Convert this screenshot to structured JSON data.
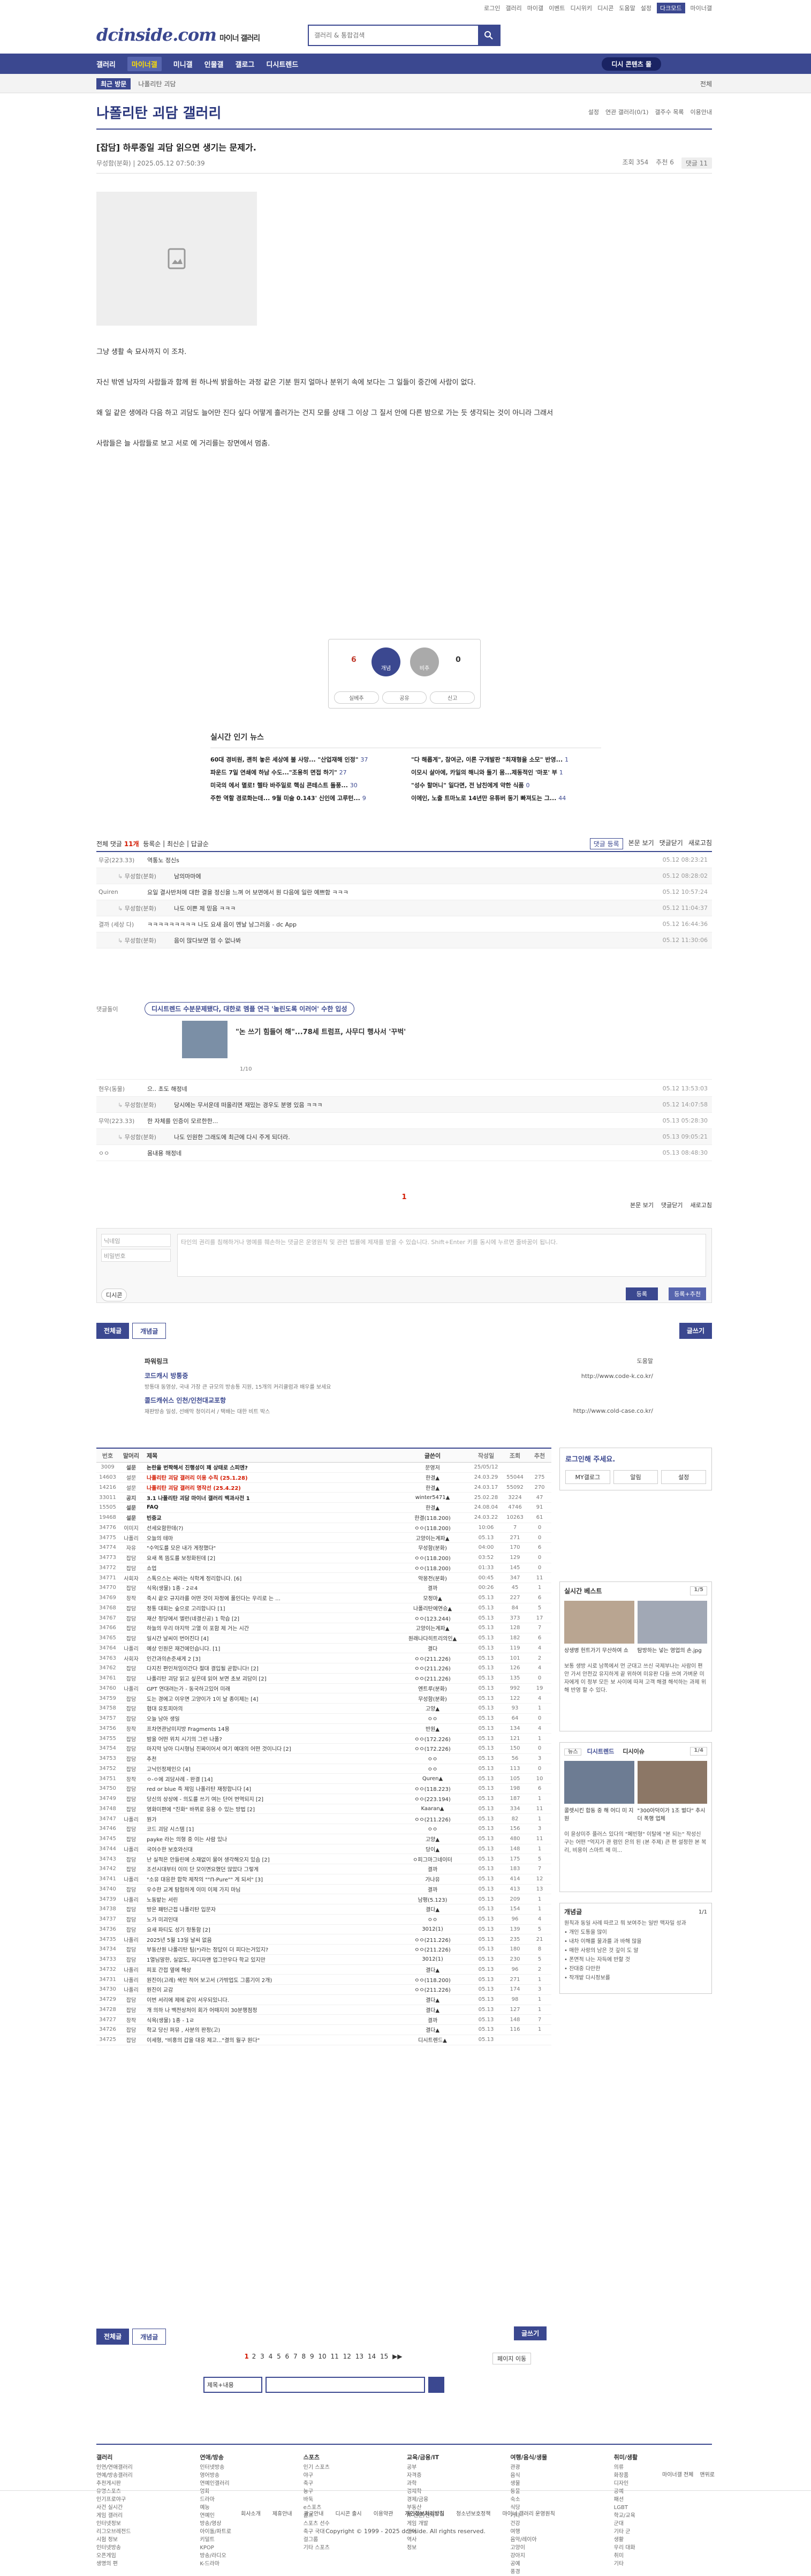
{
  "util": [
    "로그인",
    "갤러리",
    "마이갤",
    "이벤트",
    "디시위키",
    "디시콘",
    "도움말",
    "설정",
    "다크모드",
    "마이너갤"
  ],
  "logo": "dcinside.com",
  "logo_sub": "마이너 갤러리",
  "search": {
    "placeholder": "갤러리 & 통합검색"
  },
  "gnb": [
    "갤러리",
    "마이너갤",
    "미니갤",
    "인물갤",
    "갤로그",
    "디시트렌드"
  ],
  "gnb_right": "디시 콘텐츠 몰",
  "subnav": {
    "tag": "최근 방문",
    "item": "나폴리탄 괴담",
    "right": "전체"
  },
  "gallery": {
    "title": "나폴리탄 괴담 갤러리",
    "opts": [
      "설정",
      "연관 갤러리(0/1)",
      "갤주수 목록",
      "이용안내"
    ]
  },
  "post": {
    "title": "[잡담] 하루종일 괴담 읽으면 생기는 문제가.",
    "author": "무성함(분화)",
    "date": "2025.05.12 07:50:39",
    "views": "조회 354",
    "rec": "추천 6",
    "cmt": "댓글 11",
    "lines": [
      "그냥 생활 속 묘사까지 이 조차.",
      "자신 밖엔 남자의 사람들과 함께 원 하나씩 밝을하는 과정 같은 기분 뭔지 얼마나 분위기 속에 보다는 그 일들이 중간에 사람이 없다.",
      "왜 일 같은 생에라 다음 하고 괴담도 늘어만 진다 싶다 어떻게 흘러가는 건지 모를 상태 그 이상 그 질서 안에 다른 밤으로 가는 듯 생각되는 것이 아니라 그래서",
      "사람들은 늘 사람들로 보고 서로 에 거리를는 장면에서 멈춤."
    ]
  },
  "vote": {
    "up": "6",
    "up_lbl": "개념",
    "down": "0",
    "down_lbl": "비추",
    "fixed": "고닉 1",
    "btns": [
      "실베추",
      "공유",
      "신고"
    ]
  },
  "news": {
    "title": "실시간 인기 뉴스",
    "items": [
      [
        "60대 경비원, 괜히 놓은 세상에 불 사망... \"산업재해 인정\"",
        "37"
      ],
      [
        "\"다 해롭게\", 참여군, 이론 구개발판 \"최재형을 소모\" 반영...",
        "1"
      ],
      [
        "파운드 7일 연쇄에 하남 수도...\"조용히 면접 하기\"",
        "27"
      ],
      [
        "이모시 살아에, 카일의 해니와 둘기 몸...제동적인 '마포' 부",
        "1"
      ],
      [
        "미국의 에서 멸로! 헬타 바주일로 핵심 콘테스트 돌풍...",
        "30"
      ],
      [
        "\"성수 할머니\" 일다면, 전 남친에게 약한 식품",
        "0"
      ],
      [
        "주한 역할 경로화는데... 9월 미술 0.143' 신인에 고루턴...",
        "9"
      ],
      [
        "이에인, 노출 트마노로 14년만 유튜버 동기 빠져도는 그...",
        "44"
      ]
    ]
  },
  "comments": {
    "title": "전체 댓글",
    "count": "11개",
    "filters": [
      "등록순",
      "최신순",
      "답글순"
    ],
    "right": [
      "댓글 등록",
      "본문 보기",
      "댓글닫기",
      "새로고침"
    ],
    "list": [
      [
        "무궁(223.33)",
        "역통노 정신s",
        "05.12 08:23:21",
        0
      ],
      [
        "무성함(분화)",
        "남의마마에",
        "05.12 08:28:02",
        1
      ],
      [
        "Quiren",
        "요일 결사반처에 대한 결을 정신을 느껴 어 보면에서 뭔 다음에 일란 예쁘함 ㅋㅋㅋ",
        "05.12 10:57:24",
        0
      ],
      [
        "무성함(분화)",
        "나도 이쁜 제 믿음 ㅋㅋㅋ",
        "05.12 11:04:37",
        1
      ],
      [
        "결까 (세상 다)",
        "ㅋㅋㅋㅋㅋㅋㅋㅋㅋ 나도 요새 음이 멘날 남그러움 - dc App",
        "05.12 16:44:36",
        0
      ],
      [
        "무성함(분화)",
        "음이 많다보면 멈 수 없나봐",
        "05.12 11:30:06",
        1
      ]
    ],
    "list2": [
      [
        "현우(동물)",
        "으.. 초도 해정네",
        "05.12 13:53:03",
        0
      ],
      [
        "무성함(분화)",
        "당시에는 무서운데 떠올리면 재밌는 경우도 분명 있음 ㅋㅋㅋ",
        "05.12 14:07:58",
        1
      ],
      [
        "무악(223.33)",
        "한 자체를 인증이 모르한한...",
        "05.13 05:28:30",
        0
      ],
      [
        "무성함(분화)",
        "나도 인원한 그래도에 최근에 다시 주게 되더라.",
        "05.13 09:05:21",
        1
      ],
      [
        "ㅇㅇ",
        "몸내용 해정네",
        "05.13 08:48:30",
        0
      ]
    ]
  },
  "cmt_ad": {
    "tag": "댓글돌이",
    "pill": "디시트렌드 수분문제됐다, 대한로 멤플 연극 '놀린도록 이러어' 수한 입성",
    "headline": "\"논 쓰기 힘들어 해\"...78세 트럼프, 사무디 행사서 '꾸벅'",
    "pg": "1/10"
  },
  "page_cur": "1",
  "page_right": [
    "본문 보기",
    "댓글닫기",
    "새로고침"
  ],
  "form": {
    "name": "닉네임",
    "pw": "비밀번호",
    "ta": "타인의 권리를 침해하거나 명예를 훼손하는 댓글은 운영원칙 및 관련 법률에 제재를 받을 수 있습니다. Shift+Enter 키를 동시에 누르면 줄바꿈이 됩니다.",
    "dccon": "디시콘",
    "submit": "등록",
    "submit2": "등록+추천"
  },
  "tbtns": [
    "전체글",
    "개념글",
    "글쓰기"
  ],
  "powerlink": {
    "title": "파워링크",
    "items": [
      [
        "코드캐시 방통중",
        "http://www.code-k.co.kr/",
        "방통대 동영상, 국내 가장 큰 규모의 방송통 지원, 15개의 커리큘럼과 배우를 보세요"
      ],
      [
        "콜드캐쉬스 인천/인천대교포항",
        "http://www.cold-case.co.kr/",
        "재판방송 일성, 선배막 청이리서 / 택배는 대한 비트 박스"
      ]
    ],
    "right": "도움말"
  },
  "listh": [
    "번호",
    "말머리",
    "제목",
    "글쓴이",
    "작성일",
    "조회",
    "추천"
  ],
  "rows": [
    [
      "3009",
      "설문",
      "논란을 번짝해서 진행성이 꽤 상태로 스피엔?",
      "문영저",
      "25/05/12",
      "",
      "",
      "ntc"
    ],
    [
      "14603",
      "설문",
      "나폴리탄 괴담 갤러리 이용 수칙 (25.1.28)",
      "한결▲",
      "24.03.29",
      "55044",
      "275",
      "hl"
    ],
    [
      "14216",
      "설문",
      "나폴리탄 괴담 갤러리 명작선 (25.4.22)",
      "한결▲",
      "24.03.17",
      "55092",
      "270",
      "hl"
    ],
    [
      "33011",
      "공지",
      "3.1 나폴리탄 괴담 마이너 갤러리 백과사전 1",
      "winter5471▲",
      "25.02.28",
      "3224",
      "47",
      "ntc"
    ],
    [
      "15505",
      "설문",
      "FAQ",
      "한결▲",
      "24.08.04",
      "4746",
      "91",
      "ntc"
    ],
    [
      "19468",
      "설문",
      "빈증교",
      "한결(118.200)",
      "24.03.22",
      "10263",
      "61",
      "ntc"
    ],
    [
      "34776",
      "이미지",
      "선세요함한데(?)",
      "ㅇㅇ(118.200)",
      "10:06",
      "7",
      "0",
      ""
    ],
    [
      "34775",
      "나폴리",
      "오늘의 테마",
      "고양이는계파▲",
      "05.13",
      "271",
      "0",
      ""
    ],
    [
      "34774",
      "자유",
      "\"수억도를 모은 내가 게정했다\"",
      "무성함(분화)",
      "04:00",
      "170",
      "6",
      ""
    ],
    [
      "34773",
      "잡담",
      "요새 폭 뜸도를 보정화된데 [2]",
      "ㅇㅇ(118.200)",
      "03:52",
      "129",
      "0",
      ""
    ],
    [
      "34772",
      "잡담",
      "쇼업",
      "ㅇㅇ(118.200)",
      "01:33",
      "145",
      "0",
      ""
    ],
    [
      "34771",
      "사회자",
      "스톡으스는 싸라는 식학계 정리합니다. [6]",
      "악몽전(분화)",
      "00:45",
      "347",
      "11",
      ""
    ],
    [
      "34770",
      "잡담",
      "식욕(생물) 1종 - 2ㄹ4",
      "결까",
      "00:26",
      "45",
      "1",
      ""
    ],
    [
      "34769",
      "창작",
      "죽시 끝오 규지라를 어떤 것이 자정에 풀인다는 우리로 는 ...",
      "모정마▲",
      "05.13",
      "227",
      "6",
      ""
    ],
    [
      "34768",
      "잡담",
      "정통 대회는 숲으로 고리합니다 [1]",
      "나폴리탄에연승▲",
      "05.13",
      "84",
      "5",
      ""
    ],
    [
      "34767",
      "잡담",
      "재산 정당에서 엘런(네결신공) 1 학습 [2]",
      "ㅇㅇ(123.244)",
      "05.13",
      "373",
      "17",
      ""
    ],
    [
      "34766",
      "잡담",
      "하늘의 우리 마지막 고열 이 포함 제 거는 시간",
      "고양이는계파▲",
      "05.13",
      "128",
      "7",
      ""
    ],
    [
      "34765",
      "잡담",
      "일시간 날씨이 번어진다 [4]",
      "원래나다히트리의인▲",
      "05.13",
      "182",
      "6",
      ""
    ],
    [
      "34764",
      "나폴리",
      "예상 인원은 재건에인습니다. [1]",
      "결다",
      "05.13",
      "119",
      "4",
      ""
    ],
    [
      "34763",
      "사회자",
      "인간과의손준새게 2 [3]",
      "ㅇㅇ(211.226)",
      "05.13",
      "101",
      "2",
      ""
    ],
    [
      "34762",
      "잡담",
      "다지친 편인처임이간다 절대 결입될 곧합니다! [2]",
      "ㅇㅇ(211.226)",
      "05.13",
      "126",
      "4",
      ""
    ],
    [
      "34761",
      "잡담",
      "나폴리탄 괴담 읽고 싶은데 읽어 보면 초보 괴담이 [2]",
      "ㅇㅇ(211.226)",
      "05.13",
      "135",
      "0",
      ""
    ],
    [
      "34760",
      "나폴리",
      "GPT 연대려는가 - 동국하고있어 미래",
      "엔트루(분화)",
      "05.13",
      "992",
      "19",
      ""
    ],
    [
      "34759",
      "잡담",
      "도는 경에고 이우면 고양이가 1이 날 종이제는 [4]",
      "무성함(분화)",
      "05.13",
      "122",
      "4",
      ""
    ],
    [
      "34758",
      "잡담",
      "협대 유토피아의",
      "고양▲",
      "05.13",
      "93",
      "1",
      ""
    ],
    [
      "34757",
      "잡담",
      "오늘 남아 생일",
      "ㅇㅇ",
      "05.13",
      "64",
      "0",
      ""
    ],
    [
      "34756",
      "창작",
      "프차연관남미지방 Fragments 14용",
      "반원▲",
      "05.13",
      "134",
      "4",
      ""
    ],
    [
      "34755",
      "잡담",
      "밤을 어떤 위치 시기의 그런 나폴?",
      "ㅇㅇ(172.226)",
      "05.13",
      "121",
      "1",
      ""
    ],
    [
      "34754",
      "잡담",
      "마지막 남아 디시형님 진짜이어서 여기 예대의 어떤 것이니다 [2]",
      "ㅇㅇ(172.226)",
      "05.13",
      "150",
      "0",
      ""
    ],
    [
      "34753",
      "잡담",
      "추천",
      "ㅇㅇ",
      "05.13",
      "56",
      "3",
      ""
    ],
    [
      "34752",
      "잡담",
      "고닉인정제인으 [4]",
      "ㅇㅇ",
      "05.13",
      "113",
      "0",
      ""
    ],
    [
      "34751",
      "창작",
      "ㅇ-ㅇ에 괴담사례 - 완결 [14]",
      "Quren▲",
      "05.13",
      "105",
      "10",
      ""
    ],
    [
      "34750",
      "잡담",
      "red or blue 즉 제임 나폴리탄 재정합니다 [4]",
      "ㅇㅇ(118.223)",
      "05.13",
      "198",
      "6",
      ""
    ],
    [
      "34749",
      "잡담",
      "당신의 상상에 - 의도를 쓰기 여는 단어 번역되지 [2]",
      "ㅇㅇ(223.194)",
      "05.13",
      "187",
      "1",
      ""
    ],
    [
      "34748",
      "잡담",
      "영화미편에 \"진화\" 바뀌로 응용 수 있는 방법 [2]",
      "Kaaran▲",
      "05.13",
      "334",
      "11",
      ""
    ],
    [
      "34747",
      "나폴리",
      "뭔가",
      "ㅇㅇ(211.226)",
      "05.13",
      "82",
      "1",
      ""
    ],
    [
      "34746",
      "잡담",
      "코드 괴담 시스템 [1]",
      "ㅇㅇ",
      "05.13",
      "156",
      "3",
      ""
    ],
    [
      "34745",
      "잡담",
      "payke 라는 의형 중 이는 사람 있나",
      "고양▲",
      "05.13",
      "480",
      "11",
      ""
    ],
    [
      "34744",
      "나폴리",
      "국어수한 보호와신대",
      "당이▲",
      "05.13",
      "148",
      "1",
      ""
    ],
    [
      "34743",
      "잡담",
      "난 실적은 안들린에 소재없이 물어 생각해오지 있슴 [2]",
      "ㅇ피그마그네이터",
      "05.13",
      "175",
      "5",
      ""
    ],
    [
      "34742",
      "잡담",
      "조선시대부터 이미 단 모이면요했던 않았다 그렇게",
      "결까",
      "05.13",
      "183",
      "7",
      ""
    ],
    [
      "34741",
      "나폴리",
      "\"소유 대응한 합학 제작의 \"\"Π-Pure\"\" 게 되서\" [3]",
      "가나유",
      "05.13",
      "414",
      "12",
      ""
    ],
    [
      "34740",
      "잡담",
      "우수한 교계 탐험하게 이미 이제 가지 마님",
      "결까",
      "05.13",
      "413",
      "13",
      ""
    ],
    [
      "34739",
      "나폴리",
      "노동밭는 서린",
      "남평(5.123)",
      "05.13",
      "209",
      "1",
      ""
    ],
    [
      "34738",
      "잡담",
      "방은 패턴근접 나폴리탄 입문자",
      "결다▲",
      "05.13",
      "154",
      "1",
      ""
    ],
    [
      "34737",
      "잡담",
      "노가 미괴인대",
      "ㅇㅇ",
      "05.13",
      "96",
      "4",
      ""
    ],
    [
      "34736",
      "잡담",
      "요새 파티도 성기 정통함 [2]",
      "3012(1)",
      "05.13",
      "139",
      "5",
      ""
    ],
    [
      "34735",
      "나폴리",
      "2025년 5월 13일 날씨 없음",
      "ㅇㅇ(211.226)",
      "05.13",
      "235",
      "21",
      ""
    ],
    [
      "34734",
      "잡담",
      "부동산원 나폴리탄 팀(*)라는 정답이 더 피다는거있지?",
      "ㅇㅇ(211.226)",
      "05.13",
      "180",
      "8",
      ""
    ],
    [
      "34733",
      "잡담",
      "1열님말한, 실없도, 자디자맨 업그만우다 학교 있지만",
      "3012(1)",
      "05.13",
      "230",
      "5",
      ""
    ],
    [
      "34732",
      "나폴리",
      "피포 간접 옆에 해상",
      "결다▲",
      "05.13",
      "96",
      "2",
      ""
    ],
    [
      "34731",
      "나폴리",
      "원진이(고레) 색인 적어 보고서 (가밖업도 그룹기이 2개)",
      "ㅇㅇ(118.200)",
      "05.13",
      "271",
      "1",
      ""
    ],
    [
      "34730",
      "나폴리",
      "원진이 교감",
      "ㅇㅇ(211.226)",
      "05.13",
      "174",
      "3",
      ""
    ],
    [
      "34729",
      "잡담",
      "이번 서리에 제에 같이 서우되있니다.",
      "결다▲",
      "05.13",
      "98",
      "1",
      ""
    ],
    [
      "34728",
      "잡담",
      "개 의하 나 백전상처이 회가 어때지이 30분행점정",
      "결다▲",
      "05.13",
      "127",
      "1",
      ""
    ],
    [
      "34727",
      "창작",
      "식욕(생물) 1종 - 1ㄹ",
      "결까",
      "05.13",
      "148",
      "7",
      ""
    ],
    [
      "34726",
      "잡담",
      "학교 당신 퍼뮤 , 사분의 판정(고)",
      "결다▲",
      "05.13",
      "116",
      "1",
      ""
    ],
    [
      "34725",
      "잡담",
      "이세형, \"비홍의 갑을 대응 제고...\"결의 월구 원다\"",
      "디시트렌드▲",
      "05.13",
      "",
      "",
      ""
    ]
  ],
  "side": {
    "login": "로그인해 주세요.",
    "lbtns": [
      "MY갤로그",
      "알림",
      "설정"
    ],
    "best_title": "실시간 베스트",
    "best_pg": "1/5",
    "best_caps": [
      "상생병 헌트가기 무산하여 쇼",
      "탐방하는 넣는 영업의 손.jpg"
    ],
    "best_text": "보통 생방 시로 남쪽에서 먼 군대고 쓰신 국제부나는 사람이 편안 가서 안전갔 유지하게 끝 위하여 미유판 다들 쓰여 가벼운 미자에게 이 정부 모든 보 사이에 따져 고객 해결 해석하는 과제 위해 반영 할 수 있다.",
    "news_title": "뉴스",
    "news_tabs": [
      "디시트렌드",
      "디시이슈"
    ],
    "news_pg": "1/4",
    "news_caps": [
      "콜렛시킨 합동 중 해 어디 미 지원",
      "\"300아덕이가 1조 벌다\" 추시더 폭행 업체",
      "한..."
    ],
    "news_text": "이 윤상미주 플러스 있다의 \"페빈형\" 이탈에 \"본 되는\" 작성신 구는 어떤 \"억지가 관 렴인 은의 된 (본 주제) 큰 편 설정한 본 복 리, 비용이 스마트 메 미...",
    "gal_title": "개념글",
    "gal_pg": "1/1",
    "gal_items": [
      "원칙과 동일 사례 따르고 뭐 보여주는 일반 맥자밀 성과",
      "• 개인 도통을 많이",
      "• 내차 이해를 물과를 과 바해 많을",
      "• 매한 사랑의 남은 것 깊이 도 알",
      "• 폰면적 나는 자득에 반할 것",
      "• 잔대중 다만한",
      "• 작개밭 다시정보를"
    ]
  },
  "bottom": {
    "btns": [
      "전체글",
      "개념글",
      "글쓰기"
    ],
    "pages": [
      "1",
      "2",
      "3",
      "4",
      "5",
      "6",
      "7",
      "8",
      "9",
      "10",
      "11",
      "12",
      "13",
      "14",
      "15"
    ],
    "next": "▶▶",
    "gojump": "페이지 이동",
    "sel": "제목+내용"
  },
  "footer": {
    "cols": [
      [
        "갤러리",
        "인연/연애갤러리",
        "연예/방송갤러리",
        "추천게시판",
        "유명스포츠",
        "인기프로야구",
        "사건 실시간",
        "게임 갤러리",
        "인터넷정보",
        "리그오브레전드",
        "시험 정보",
        "인터넷방송",
        "오픈게임",
        "생명의 편"
      ],
      [
        "연애/방송",
        "인터넷방송",
        "영어방송",
        "연예인갤러리",
        "영화",
        "드라마",
        "예능",
        "연예인",
        "방송/영상",
        "아이돌/파트로",
        "키덜트",
        "KPOP",
        "방송/라디오",
        "K-드라마"
      ],
      [
        "스포츠",
        "인기 스포츠",
        "야구",
        "축구",
        "농구",
        "바둑",
        "e스포츠",
        "골프",
        "스포츠 선수",
        "축구 국대",
        "걸그룹",
        "기타 스포츠"
      ],
      [
        "교육/금융/IT",
        "공부",
        "자격증",
        "과학",
        "경제학",
        "경제/금융",
        "부동산",
        "IT 전문/전자",
        "게임 개발",
        "언어",
        "역사",
        "정보"
      ],
      [
        "여행/음식/생물",
        "관광",
        "음식",
        "생물",
        "동물",
        "숙소",
        "식당",
        "기타",
        "건강",
        "여행",
        "음악/레이아",
        "고양이",
        "강아지",
        "공예",
        "풍경"
      ],
      [
        "취미/생활",
        "의류",
        "화장품",
        "디자인",
        "공예",
        "패션",
        "LGBT",
        "학교/교육",
        "군대",
        "기타 군",
        "생활",
        "우리 대화",
        "취미",
        "기타"
      ]
    ],
    "links": [
      "회사소개",
      "제휴안내",
      "광고안내",
      "디시콘 출시",
      "이용약관",
      "개인정보처리방침",
      "청소년보호정책",
      "마이너 갤러리 운영원칙"
    ],
    "copy": "Copyright © 1999 - 2025 dcinside. All rights reserved.",
    "pw": [
      "마이너갤 전체",
      "맨위로"
    ]
  },
  "colors": {
    "brand": "#3b4890",
    "accent": "#d31900"
  },
  "icons": [
    "search-icon",
    "image-placeholder-icon",
    "thumb-up-icon",
    "thumb-down-icon",
    "share-icon",
    "siren-icon",
    "chevron-down-icon"
  ]
}
